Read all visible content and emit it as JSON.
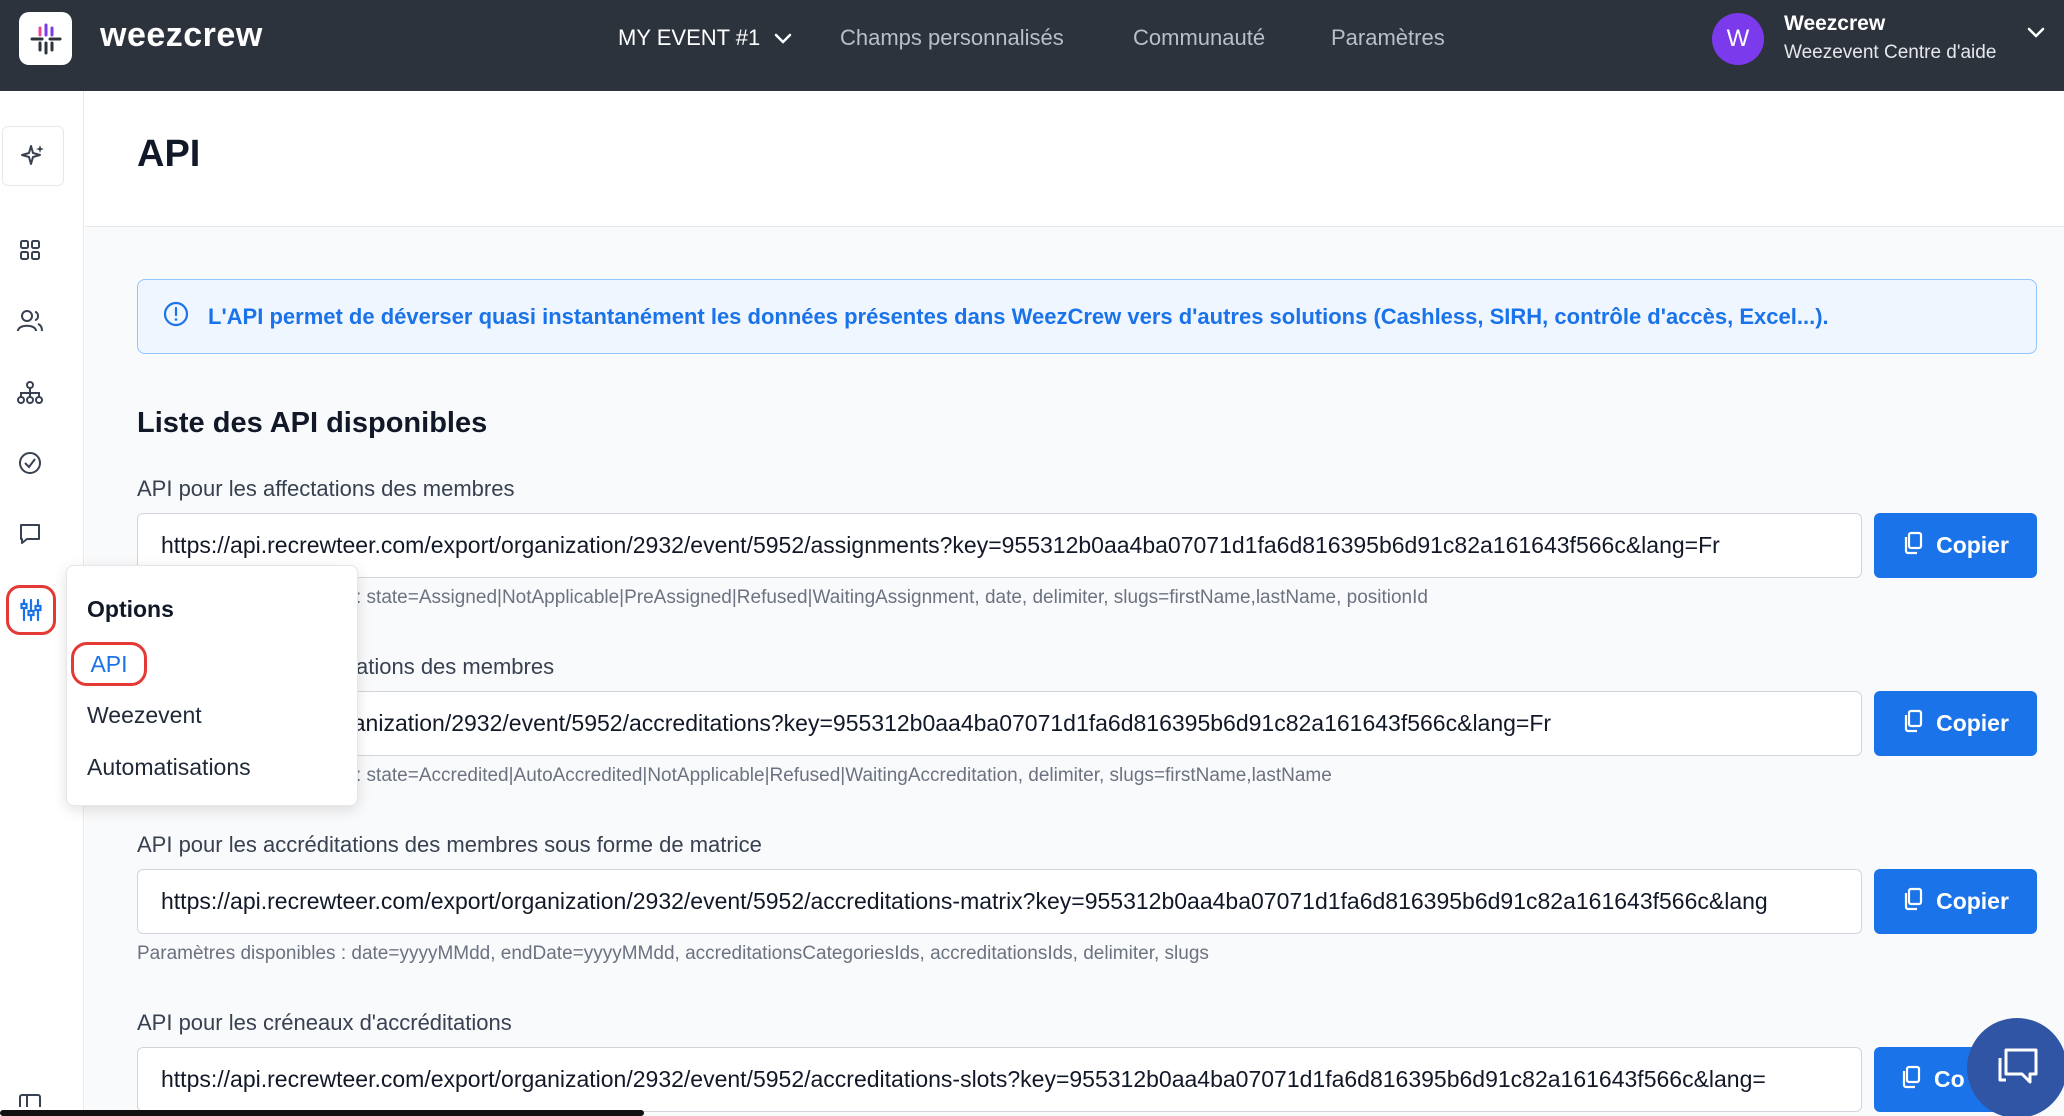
{
  "topbar": {
    "brand": "weezcrew",
    "event_selector": "MY EVENT #1",
    "nav": [
      "Champs personnalisés",
      "Communauté",
      "Paramètres"
    ],
    "user": {
      "initial": "W",
      "name": "Weezcrew",
      "subtitle": "Weezevent Centre d'aide"
    }
  },
  "sidebar": {
    "icons": [
      "sparkle-icon",
      "dashboard-icon",
      "users-icon",
      "org-chart-icon",
      "check-circle-icon",
      "chat-icon",
      "sliders-icon"
    ],
    "active": "sliders-icon"
  },
  "page": {
    "title": "API"
  },
  "banner": {
    "text": "L'API permet de déverser quasi instantanément les données présentes dans WeezCrew vers d'autres solutions (Cashless, SIRH, contrôle d'accès, Excel...)."
  },
  "section": {
    "title": "Liste des API disponibles"
  },
  "copy_label": "Copier",
  "apis": [
    {
      "label": "API pour les affectations des membres",
      "url": "https://api.recrewteer.com/export/organization/2932/event/5952/assignments?key=955312b0aa4ba07071d1fa6d816395b6d91c82a161643f566c&lang=Fr",
      "params": ": state=Assigned|NotApplicable|PreAssigned|Refused|WaitingAssignment, date, delimiter, slugs=firstName,lastName, positionId"
    },
    {
      "label": "ations des membres",
      "url": "eer.com/export/organization/2932/event/5952/accreditations?key=955312b0aa4ba07071d1fa6d816395b6d91c82a161643f566c&lang=Fr",
      "params": ": state=Accredited|AutoAccredited|NotApplicable|Refused|WaitingAccreditation, delimiter, slugs=firstName,lastName"
    },
    {
      "label": "API pour les accréditations des membres sous forme de matrice",
      "url": "https://api.recrewteer.com/export/organization/2932/event/5952/accreditations-matrix?key=955312b0aa4ba07071d1fa6d816395b6d91c82a161643f566c&lang",
      "params": "Paramètres disponibles : date=yyyyMMdd, endDate=yyyyMMdd, accreditationsCategoriesIds, accreditationsIds, delimiter, slugs"
    },
    {
      "label": "API pour les créneaux d'accréditations",
      "url": "https://api.recrewteer.com/export/organization/2932/event/5952/accreditations-slots?key=955312b0aa4ba07071d1fa6d816395b6d91c82a161643f566c&lang=",
      "copy_partial": "Co"
    }
  ],
  "options_menu": {
    "title": "Options",
    "items": [
      "API",
      "Weezevent",
      "Automatisations"
    ],
    "selected": "API"
  },
  "colors": {
    "topbar": "#2c333d",
    "accent": "#1a73e8",
    "avatar": "#7c3aed",
    "highlight": "#e53935"
  }
}
